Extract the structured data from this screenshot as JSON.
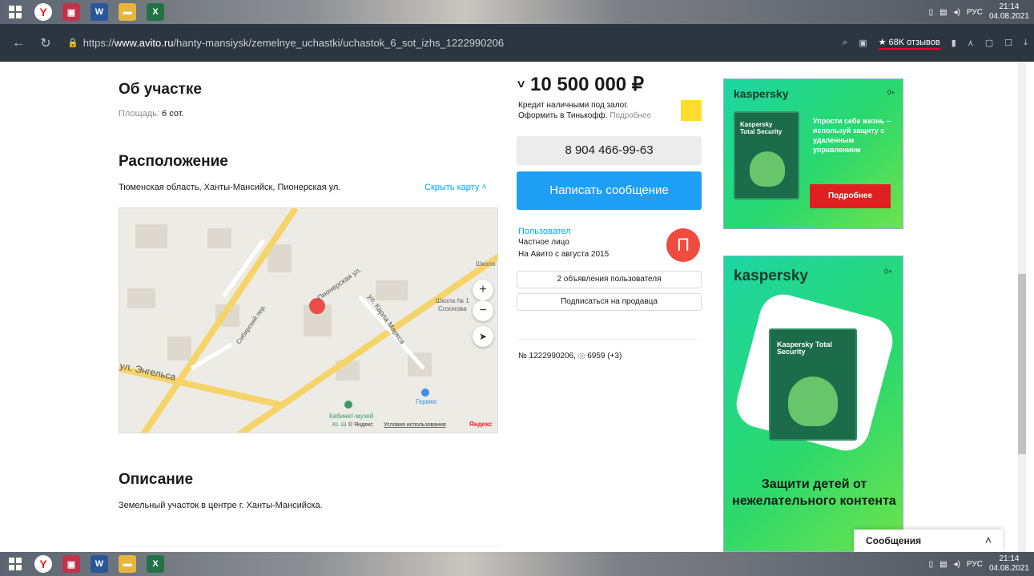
{
  "taskbar": {
    "time": "21:14",
    "date": "04.08.2021",
    "lang": "РУС"
  },
  "browser": {
    "url_prefix": "https://",
    "url_domain": "www.avito.ru",
    "url_path": "/hanty-mansiysk/zemelnye_uchastki/uchastok_6_sot_izhs_1222990206",
    "reviews_label": "★ 68K отзывов"
  },
  "about": {
    "title": "Об участке",
    "area_label": "Площадь:",
    "area_value": "6 сот."
  },
  "location": {
    "title": "Расположение",
    "address": "Тюменская область, Ханты-Мансийск, Пионерская ул.",
    "hide_map": "Скрыть карту",
    "map_labels": {
      "street1": "Пионерская ул.",
      "street2": "ул. Карла Маркса",
      "street3": "ул. Энгельса",
      "street4": "Сибирский пер.",
      "school1": "Школа №",
      "school2": "Школа № 1",
      "school3": "Созонова",
      "pharmacy": "Гермес",
      "museum": "Кабинет-музей",
      "museum2": "Ю. Ш",
      "copyright": "© Яндекс",
      "terms": "Условия использования",
      "yandex": "Яндекс"
    }
  },
  "description": {
    "title": "Описание",
    "text": "Земельный участок в центре г. Ханты-Мансийска."
  },
  "offer": {
    "price": "10 500 000 ₽",
    "credit_line1": "Кредит наличными под залог.",
    "credit_line2": "Оформить в Тинькофф.",
    "credit_more": "Подробнее",
    "phone": "8 904 466-99-63",
    "write_message": "Написать сообщение",
    "user_name": "Пользовател",
    "user_type": "Частное лицо",
    "user_since": "На Авито с августа 2015",
    "avatar_letter": "П",
    "user_ads": "2 объявления пользователя",
    "subscribe": "Подписаться на продавца",
    "ad_number": "№ 1222990206,",
    "views": "6959 (+3)"
  },
  "ads": {
    "ad1": {
      "brand": "kaspersky",
      "age": "0+",
      "text": "Упрости себе жизнь – используй защиту с удаленным управлением",
      "button": "Подробнее",
      "box_title": "Kaspersky Total Security"
    },
    "ad2": {
      "brand": "kaspersky",
      "age": "0+",
      "text": "Защити детей от нежелательного контента",
      "box_title": "Kaspersky Total Security"
    }
  },
  "chat": {
    "label": "Сообщения"
  }
}
